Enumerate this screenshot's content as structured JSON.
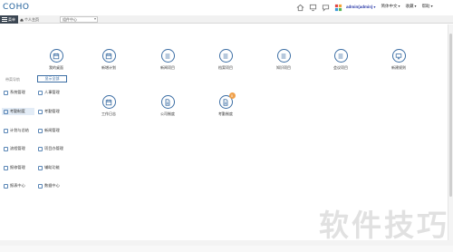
{
  "app": {
    "logo": "COHO"
  },
  "topbar": {
    "icons": [
      "home-icon",
      "monitor-icon",
      "chat-icon",
      "apps-grid-icon"
    ],
    "user": "admin(admin)",
    "links": [
      "简体中文",
      "收藏",
      "帮助"
    ]
  },
  "tabbar": {
    "menu_label": "菜单",
    "home_label": "个人主页",
    "search_value": "组件中心"
  },
  "modules": [
    {
      "label": "我的桌面",
      "icon": "calendar-icon"
    },
    {
      "label": "新增计划",
      "icon": "calendar-icon"
    },
    {
      "label": "新闻项目",
      "icon": "list-icon"
    },
    {
      "label": "档案项目",
      "icon": "list-icon"
    },
    {
      "label": "知识项目",
      "icon": "list-icon"
    },
    {
      "label": "会议项目",
      "icon": "list-icon"
    },
    {
      "label": "新建规则",
      "icon": "monitor-icon"
    },
    {
      "label": "工作日志",
      "icon": "calendar-icon"
    },
    {
      "label": "公司制度",
      "icon": "document-icon"
    },
    {
      "label": "考勤制度",
      "icon": "document-icon",
      "badge": "0"
    }
  ],
  "leftpanel": {
    "title": "带菜导航",
    "button": "显示全部",
    "items": [
      {
        "label": "系统管理"
      },
      {
        "label": "人事管理"
      },
      {
        "label": "考勤制度"
      },
      {
        "label": "考勤管理"
      },
      {
        "label": "计划与总结"
      },
      {
        "label": "新闻管理"
      },
      {
        "label": "流程管理"
      },
      {
        "label": "项目办管理"
      },
      {
        "label": "报修管理"
      },
      {
        "label": "辅助功能"
      },
      {
        "label": "报表中心"
      },
      {
        "label": "数据中心"
      }
    ]
  },
  "watermark": "软件技巧",
  "colors": {
    "accent": "#3c6ea4",
    "logo": "#1f5f9a",
    "badge": "#f0a14b",
    "dark": "#3b4652"
  }
}
